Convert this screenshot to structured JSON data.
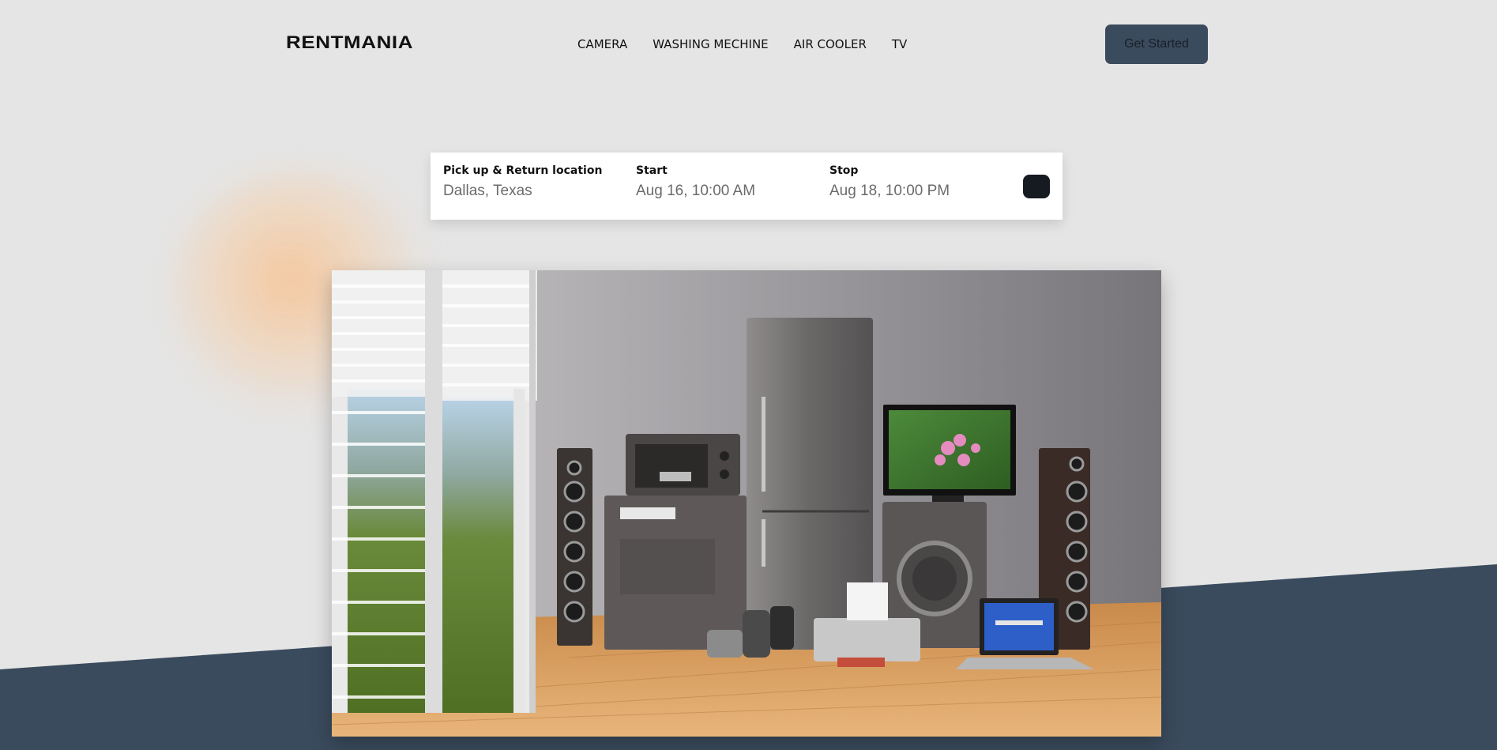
{
  "brand": {
    "name": "RENTMANIA"
  },
  "nav": {
    "items": [
      "CAMERA",
      "WASHING MECHINE",
      "AIR COOLER",
      "TV"
    ]
  },
  "header": {
    "cta_label": "Get Started"
  },
  "search": {
    "location": {
      "label": "Pick up & Return location",
      "value": "Dallas, Texas"
    },
    "start": {
      "label": "Start",
      "value": "Aug 16, 10:00 AM"
    },
    "stop": {
      "label": "Stop",
      "value": "Aug 18, 10:00 PM"
    }
  },
  "colors": {
    "background": "#e5e5e5",
    "accent": "#3a4b5d",
    "search_button": "#151b21"
  }
}
